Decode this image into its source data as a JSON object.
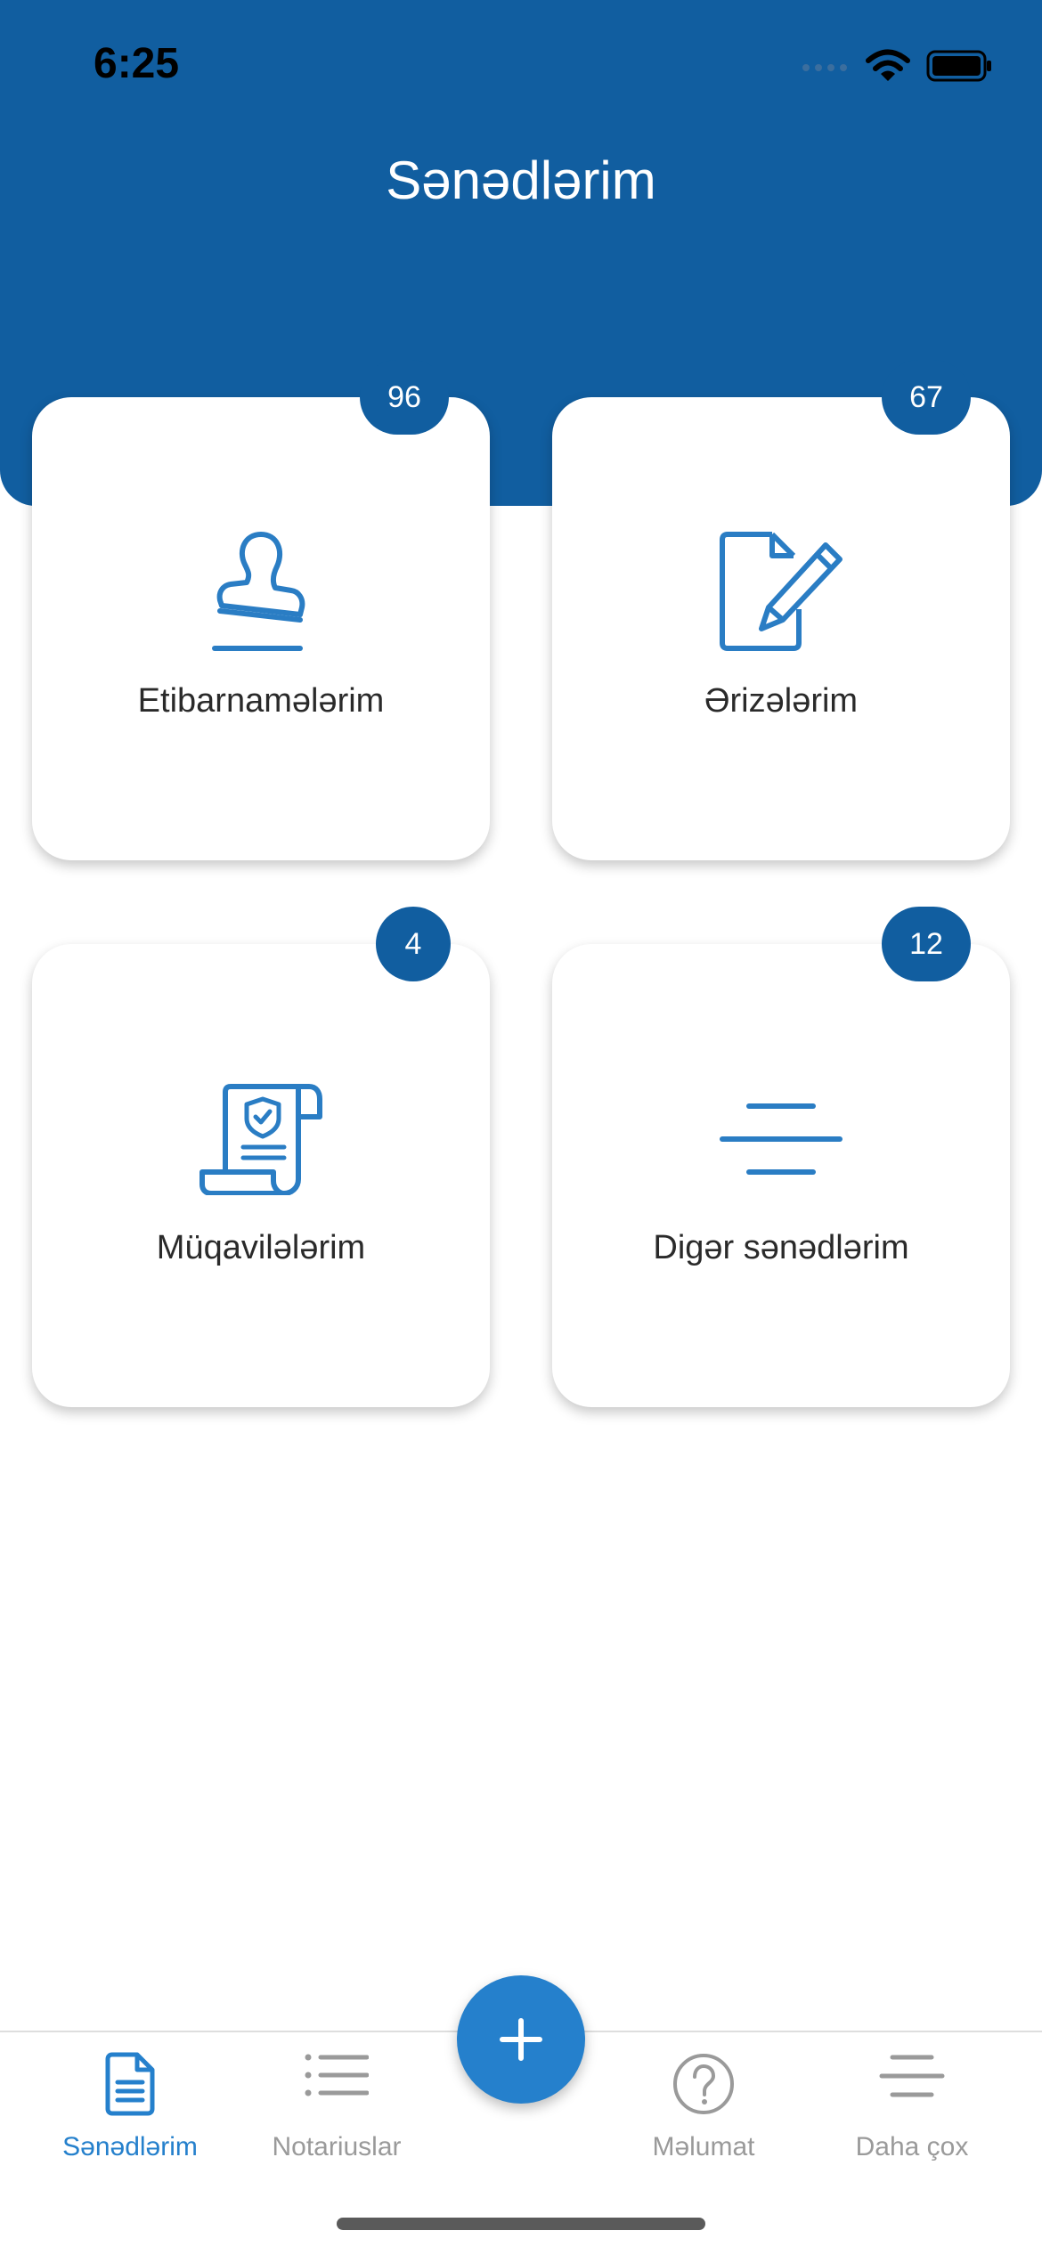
{
  "status_bar": {
    "time": "6:25"
  },
  "header": {
    "title": "Sənədlərim"
  },
  "cards": [
    {
      "label": "Etibarnamələrim",
      "badge": "96",
      "icon": "stamp-icon"
    },
    {
      "label": "Ərizələrim",
      "badge": "67",
      "icon": "document-edit-icon"
    },
    {
      "label": "Müqavilələrim",
      "badge": "4",
      "icon": "contract-scroll-icon"
    },
    {
      "label": "Digər sənədlərim",
      "badge": "12",
      "icon": "lines-icon"
    }
  ],
  "tabs": [
    {
      "label": "Sənədlərim",
      "icon": "document-icon",
      "active": true
    },
    {
      "label": "Notariuslar",
      "icon": "list-icon",
      "active": false
    },
    {
      "label": "Məlumat",
      "icon": "question-circle-icon",
      "active": false
    },
    {
      "label": "Daha çox",
      "icon": "menu-icon",
      "active": false
    }
  ],
  "fab": {
    "icon": "plus-icon"
  },
  "colors": {
    "primary": "#115ea0",
    "accent": "#2580cc",
    "icon_blue": "#2a7dc4",
    "tab_inactive": "#9a9a9a"
  }
}
